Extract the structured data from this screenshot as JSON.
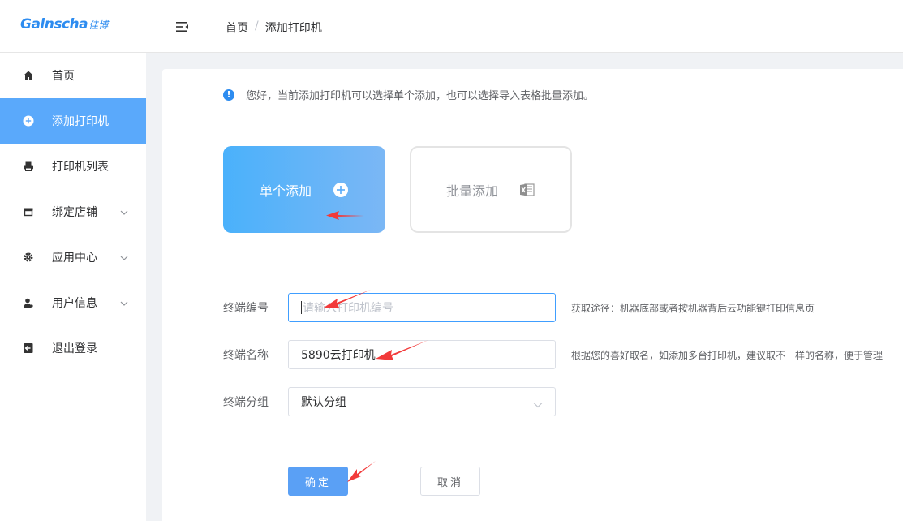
{
  "header": {
    "logo_brand": "Galnscha",
    "logo_cn": "佳博",
    "breadcrumb": [
      "首页",
      "添加打印机"
    ]
  },
  "sidebar": {
    "items": [
      {
        "label": "首页",
        "icon": "home-icon",
        "active": false,
        "expandable": false
      },
      {
        "label": "添加打印机",
        "icon": "plus-circle-icon",
        "active": true,
        "expandable": false
      },
      {
        "label": "打印机列表",
        "icon": "printer-icon",
        "active": false,
        "expandable": false
      },
      {
        "label": "绑定店铺",
        "icon": "store-icon",
        "active": false,
        "expandable": true
      },
      {
        "label": "应用中心",
        "icon": "gear-icon",
        "active": false,
        "expandable": true
      },
      {
        "label": "用户信息",
        "icon": "user-icon",
        "active": false,
        "expandable": true
      },
      {
        "label": "退出登录",
        "icon": "logout-icon",
        "active": false,
        "expandable": false
      }
    ]
  },
  "main": {
    "notice": "您好，当前添加打印机可以选择单个添加，也可以选择导入表格批量添加。",
    "mode_single": "单个添加",
    "mode_batch": "批量添加",
    "form": {
      "terminal_id_label": "终端编号",
      "terminal_id_placeholder": "请输入打印机编号",
      "terminal_id_hint": "获取途径：机器底部或者按机器背后云功能键打印信息页",
      "terminal_name_label": "终端名称",
      "terminal_name_value": "5890云打印机",
      "terminal_name_hint": "根据您的喜好取名，如添加多台打印机，建议取不一样的名称，便于管理",
      "terminal_group_label": "终端分组",
      "terminal_group_value": "默认分组"
    },
    "confirm_label": "确定",
    "cancel_label": "取消"
  },
  "colors": {
    "accent": "#5aa9fb",
    "annotation_arrow": "#f23a3a"
  }
}
